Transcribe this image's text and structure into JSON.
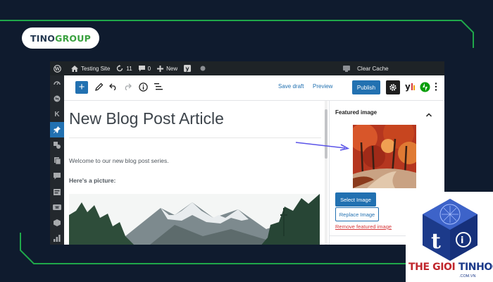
{
  "brand": {
    "logo_left": "TINO",
    "logo_right": "GROUP"
  },
  "admin_bar": {
    "site_name": "Testing Site",
    "updates_count": "11",
    "comments_count": "0",
    "new_label": "New",
    "clear_cache_label": "Clear Cache"
  },
  "toolbar": {
    "add_label": "+",
    "save_draft_label": "Save draft",
    "preview_label": "Preview",
    "publish_label": "Publish"
  },
  "editor": {
    "post_title": "New Blog Post Article",
    "paragraph": "Welcome to our new blog post series.",
    "picture_heading": "Here's a picture:"
  },
  "sidebar_panel": {
    "title": "Featured image",
    "select_label": "Select Image",
    "replace_label": "Replace Image",
    "remove_label": "Remove featured image"
  },
  "footer_brand": {
    "name_red": "THE GIOI",
    "name_blue": "TINHOC",
    "domain": ".COM.VN"
  },
  "colors": {
    "background": "#0f1b2e",
    "frame_green": "#1fa84a",
    "wp_blue": "#2271b1",
    "admin_dark": "#1e2327",
    "remove_red": "#d63638"
  }
}
